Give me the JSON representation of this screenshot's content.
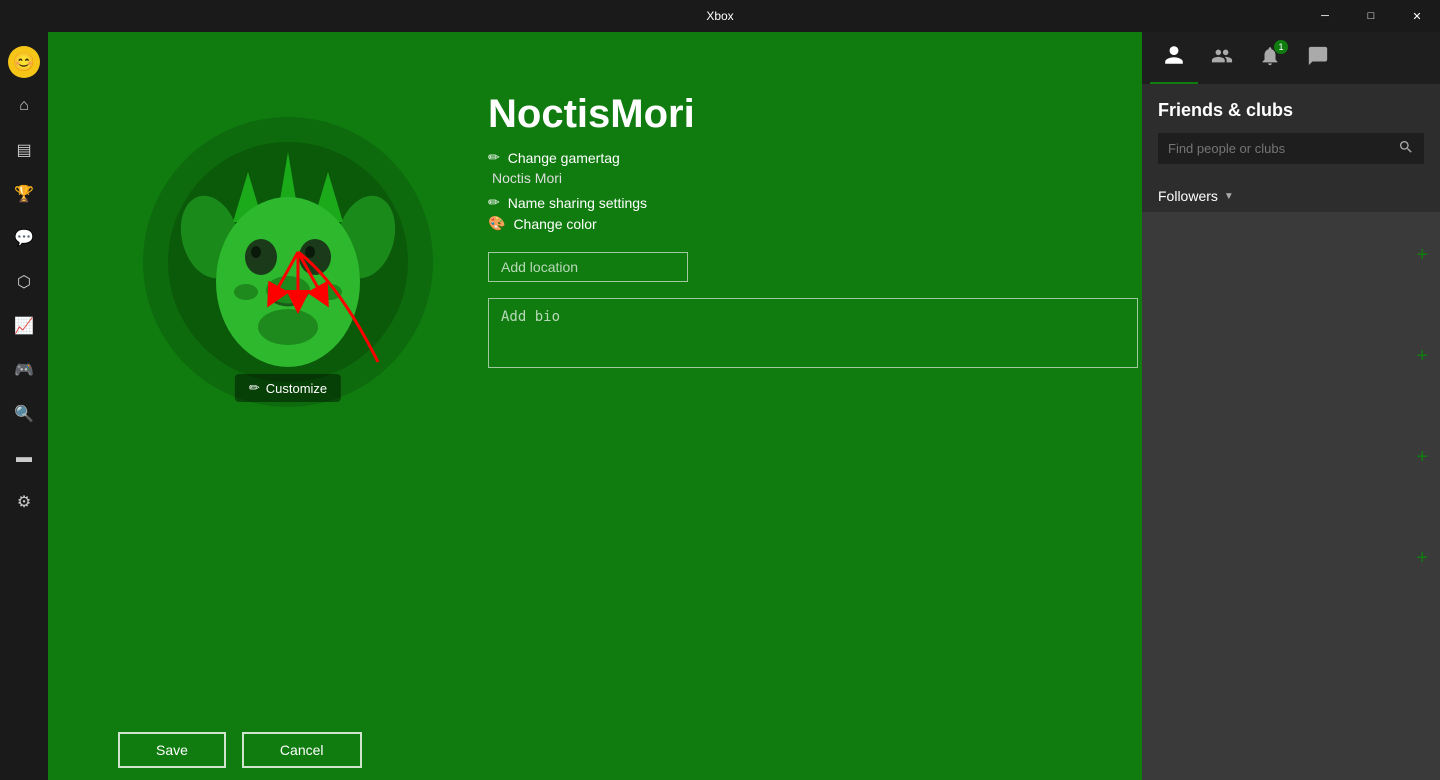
{
  "titleBar": {
    "title": "Xbox",
    "minimize": "─",
    "maximize": "□",
    "close": "✕"
  },
  "sidebar": {
    "avatar_emoji": "😊",
    "items": [
      {
        "name": "home",
        "icon": "⌂",
        "label": "Home"
      },
      {
        "name": "store",
        "icon": "▤",
        "label": "Store"
      },
      {
        "name": "achievements",
        "icon": "🏆",
        "label": "Achievements"
      },
      {
        "name": "social",
        "icon": "💬",
        "label": "Social"
      },
      {
        "name": "shield",
        "icon": "⬡",
        "label": "Privacy"
      },
      {
        "name": "trending",
        "icon": "📈",
        "label": "Trending"
      },
      {
        "name": "game",
        "icon": "🎮",
        "label": "Game"
      },
      {
        "name": "search",
        "icon": "🔍",
        "label": "Search"
      },
      {
        "name": "capture",
        "icon": "▬",
        "label": "Capture"
      },
      {
        "name": "settings",
        "icon": "⚙",
        "label": "Settings"
      }
    ]
  },
  "profile": {
    "gamertag": "NoctisMori",
    "change_gamertag": "Change gamertag",
    "real_name": "Noctis Mori",
    "name_sharing": "Name sharing settings",
    "change_color": "Change color",
    "customize_label": "Customize",
    "add_location_placeholder": "Add location",
    "add_bio_placeholder": "Add bio"
  },
  "buttons": {
    "save": "Save",
    "cancel": "Cancel"
  },
  "rightPanel": {
    "title": "Friends & clubs",
    "search_placeholder": "Find people or clubs",
    "followers_label": "Followers",
    "tabs": [
      {
        "name": "friends",
        "icon": "👤",
        "active": true,
        "badge": null
      },
      {
        "name": "multiplayer",
        "icon": "👥",
        "active": false,
        "badge": null
      },
      {
        "name": "notifications",
        "icon": "🔔",
        "active": false,
        "badge": "1"
      },
      {
        "name": "messages",
        "icon": "✉",
        "active": false,
        "badge": null
      }
    ],
    "add_buttons": [
      "+",
      "+",
      "+",
      "+"
    ]
  }
}
